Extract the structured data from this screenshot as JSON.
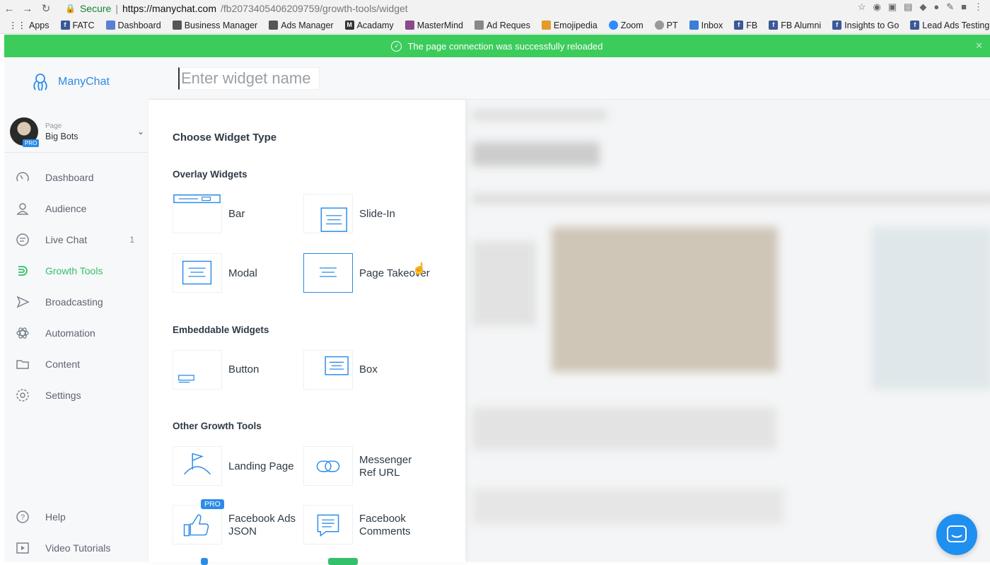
{
  "browser": {
    "secure_label": "Secure",
    "url_host": "https://manychat.com",
    "url_path": "/fb207340540620975​9/growth-tools/widget",
    "bookmarks": [
      "Apps",
      "FATC",
      "Dashboard",
      "Business Manager",
      "Ads Manager",
      "Acadamy",
      "MasterMind",
      "Ad Reques",
      "Emojipedia",
      "Zoom",
      "PT",
      "Inbox",
      "FB",
      "FB Alumni",
      "Insights to Go",
      "Lead Ads Testing"
    ]
  },
  "banner": {
    "message": "The page connection was successfully reloaded"
  },
  "sidebar": {
    "brand": "ManyChat",
    "page_label": "Page",
    "page_name": "Big Bots",
    "pro_badge": "PRO",
    "items": [
      {
        "label": "Dashboard",
        "icon": "speedometer-icon"
      },
      {
        "label": "Audience",
        "icon": "person-icon"
      },
      {
        "label": "Live Chat",
        "icon": "chat-bubble-icon",
        "count": "1"
      },
      {
        "label": "Growth Tools",
        "icon": "growth-icon",
        "active": true
      },
      {
        "label": "Broadcasting",
        "icon": "send-icon"
      },
      {
        "label": "Automation",
        "icon": "atom-icon"
      },
      {
        "label": "Content",
        "icon": "folder-icon"
      },
      {
        "label": "Settings",
        "icon": "gear-icon"
      }
    ],
    "footer": [
      {
        "label": "Help",
        "icon": "help-icon"
      },
      {
        "label": "Video Tutorials",
        "icon": "video-icon"
      }
    ]
  },
  "topbar": {
    "widget_name_placeholder": "Enter widget name"
  },
  "panel": {
    "title": "Choose Widget Type",
    "overlay_title": "Overlay Widgets",
    "embeddable_title": "Embeddable Widgets",
    "other_title": "Other Growth Tools",
    "widgets": {
      "bar": "Bar",
      "slide_in": "Slide-In",
      "modal": "Modal",
      "page_takeover": "Page Takeover",
      "button": "Button",
      "box": "Box",
      "landing_page": "Landing Page",
      "messenger_ref_line1": "Messenger",
      "messenger_ref_line2": "Ref URL",
      "fb_ads_line1": "Facebook Ads",
      "fb_ads_line2": "JSON",
      "fb_comments_line1": "Facebook",
      "fb_comments_line2": "Comments"
    },
    "pro_tag": "PRO",
    "colors": {
      "accent": "#2c8be8",
      "active_nav": "#34c06a",
      "banner": "#3ccc5c"
    }
  }
}
